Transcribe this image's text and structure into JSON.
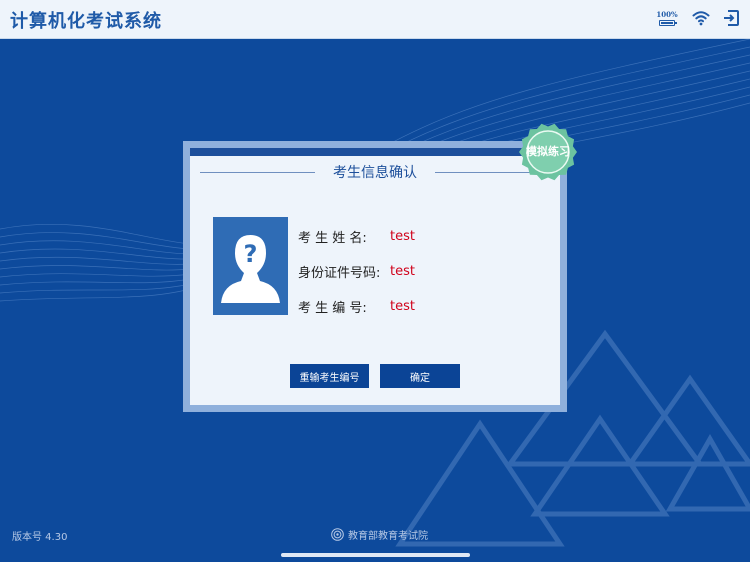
{
  "header": {
    "app_title": "计算机化考试系统",
    "battery_percent_text": "100%",
    "battery_level": 1.0,
    "icons": [
      "battery-icon",
      "wifi-icon",
      "exit-icon"
    ]
  },
  "dialog": {
    "title": "考生信息确认",
    "badge": "模拟练习",
    "fields": [
      {
        "label": "考 生 姓 名:",
        "value": "test"
      },
      {
        "label": "身份证件号码:",
        "value": "test"
      },
      {
        "label": "考 生 编 号:",
        "value": "test"
      }
    ],
    "buttons": {
      "reenter": "重输考生编号",
      "confirm": "确定"
    }
  },
  "footer": {
    "version": "版本号 4.30",
    "org": "教育部教育考试院"
  },
  "colors": {
    "background": "#0d4a9c",
    "header": "#eef4fb",
    "accent": "#1d4f9b",
    "value": "#d0021b",
    "badge": "#6cc3a0"
  }
}
